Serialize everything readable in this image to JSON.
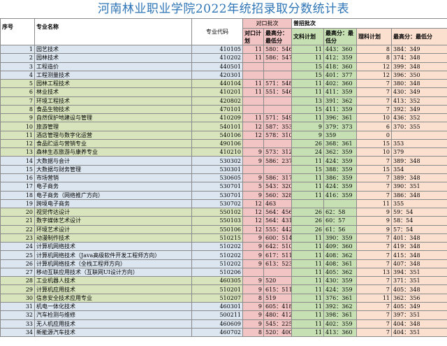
{
  "title": "河南林业职业学院2022年统招录取分数统计表",
  "headers": {
    "seq": "序号",
    "major": "专业名称",
    "code": "专业代码",
    "duikou_group": "对口批次",
    "puzhao_group": "普招批次",
    "dk_plan": "对口计划",
    "dk_score": "最高分：最低分",
    "wk_plan": "文科计划",
    "wk_score": "最高分：最低分",
    "lk_plan": "理科计划",
    "lk_score": "最高分：最低分"
  },
  "rows": [
    {
      "seq": "1",
      "major": "园艺技术",
      "code": "410105",
      "dk_plan": "11",
      "dk_score": "580：546",
      "wk_plan": "11",
      "wk_score": "443：360",
      "lk_plan": "8",
      "lk_score": "384：349"
    },
    {
      "seq": "2",
      "major": "园林技术",
      "code": "410202",
      "dk_plan": "11",
      "dk_score": "586：547",
      "wk_plan": "11",
      "wk_score": "412：359",
      "lk_plan": "8",
      "lk_score": "374：348"
    },
    {
      "seq": "3",
      "major": "工程造价",
      "code": "440501",
      "dk_plan": "",
      "dk_score": "",
      "wk_plan": "15",
      "wk_score": "418：360",
      "lk_plan": "12",
      "lk_score": "399：348"
    },
    {
      "seq": "4",
      "major": "工程测量技术",
      "code": "420301",
      "dk_plan": "",
      "dk_score": "",
      "wk_plan": "15",
      "wk_score": "401：377",
      "lk_plan": "12",
      "lk_score": "396：350"
    },
    {
      "seq": "5",
      "major": "园林工程技术",
      "code": "440104",
      "dk_plan": "11",
      "dk_score": "571：548",
      "wk_plan": "11",
      "wk_score": "402：360",
      "lk_plan": "7",
      "lk_score": "380：348"
    },
    {
      "seq": "6",
      "major": "林业技术",
      "code": "410201",
      "dk_plan": "11",
      "dk_score": "551：546",
      "wk_plan": "11",
      "wk_score": "411：359",
      "lk_plan": "7",
      "lk_score": "430：349"
    },
    {
      "seq": "7",
      "major": "环境工程技术",
      "code": "420802",
      "dk_plan": "",
      "dk_score": "",
      "wk_plan": "13",
      "wk_score": "391：362",
      "lk_plan": "7",
      "lk_score": "413：352"
    },
    {
      "seq": "8",
      "major": "食品生物技术",
      "code": "470101",
      "dk_plan": "",
      "dk_score": "",
      "wk_plan": "15",
      "wk_score": "411：359",
      "lk_plan": "7",
      "lk_score": "392：349"
    },
    {
      "seq": "9",
      "major": "自然保护地建设与管理",
      "code": "410209",
      "dk_plan": "11",
      "dk_score": "571：549",
      "wk_plan": "11",
      "wk_score": "396：361",
      "lk_plan": "10",
      "lk_score": "436：352"
    },
    {
      "seq": "10",
      "major": "旅游管理",
      "code": "540101",
      "dk_plan": "12",
      "dk_score": "587：353",
      "wk_plan": "9",
      "wk_score": "379：373",
      "lk_plan": "6",
      "lk_score": "370：355"
    },
    {
      "seq": "11",
      "major": "酒店管理与数字化运营",
      "code": "540106",
      "dk_plan": "12",
      "dk_score": "578：310",
      "wk_plan": "9",
      "wk_score": "359",
      "lk_plan": "0",
      "lk_score": ""
    },
    {
      "seq": "12",
      "major": "食品贮运与营销专业",
      "code": "490106",
      "dk_plan": "",
      "dk_score": "",
      "wk_plan": "26",
      "wk_score": "368：361",
      "lk_plan": "15",
      "lk_score": "353"
    },
    {
      "seq": "13",
      "major": "森林生态旅游与康养专业",
      "code": "410210",
      "dk_plan": "9",
      "dk_score": "573：312",
      "wk_plan": "24",
      "wk_score": "362：359",
      "lk_plan": "10",
      "lk_score": "379"
    },
    {
      "seq": "14",
      "major": "大数据与会计",
      "code": "530302",
      "dk_plan": "9",
      "dk_score": "586：237",
      "wk_plan": "11",
      "wk_score": "424：359",
      "lk_plan": "7",
      "lk_score": "389：348"
    },
    {
      "seq": "15",
      "major": "大数据与财务管理",
      "code": "530301",
      "dk_plan": "",
      "dk_score": "",
      "wk_plan": "15",
      "wk_score": "388：359",
      "lk_plan": "15",
      "lk_score": "354"
    },
    {
      "seq": "16",
      "major": "市场营销",
      "code": "530605",
      "dk_plan": "9",
      "dk_score": "586：317",
      "wk_plan": "11",
      "wk_score": "386：359",
      "lk_plan": "7",
      "lk_score": "389：348"
    },
    {
      "seq": "17",
      "major": "电子商务",
      "code": "530701",
      "dk_plan": "5",
      "dk_score": "543：320",
      "wk_plan": "11",
      "wk_score": "424：359",
      "lk_plan": "7",
      "lk_score": "390：351"
    },
    {
      "seq": "18",
      "major": "电子商务（网络推广方向）",
      "code": "530701",
      "dk_plan": "9",
      "dk_score": "560：328",
      "wk_plan": "11",
      "wk_score": "416：359",
      "lk_plan": "7",
      "lk_score": "386：348"
    },
    {
      "seq": "19",
      "major": "跨境电子商务",
      "code": "530702",
      "dk_plan": "12",
      "dk_score": "463",
      "wk_plan": "",
      "wk_score": "",
      "lk_plan": "11",
      "lk_score": "355"
    },
    {
      "seq": "20",
      "major": "视觉传达设计",
      "code": "550102",
      "dk_plan": "12",
      "dk_score": "564：456",
      "wk_plan": "26",
      "wk_score": "62：58",
      "lk_plan": "9",
      "lk_score": "59：54"
    },
    {
      "seq": "21",
      "major": "数字媒体艺术设计",
      "code": "550103",
      "dk_plan": "12",
      "dk_score": "564：431",
      "wk_plan": "26",
      "wk_score": "60：57",
      "lk_plan": "9",
      "lk_score": "58：54"
    },
    {
      "seq": "22",
      "major": "环境艺术设计",
      "code": "550106",
      "dk_plan": "12",
      "dk_score": "555：442",
      "wk_plan": "26",
      "wk_score": "61：56",
      "lk_plan": "9",
      "lk_score": "57：54"
    },
    {
      "seq": "23",
      "major": "动漫制作技术",
      "code": "510215",
      "dk_plan": "9",
      "dk_score": "600：514",
      "wk_plan": "11",
      "wk_score": "390：359",
      "lk_plan": "7",
      "lk_score": "401：348"
    },
    {
      "seq": "24",
      "major": "计算机网络技术",
      "code": "510202",
      "dk_plan": "9",
      "dk_score": "642：510",
      "wk_plan": "11",
      "wk_score": "409：360",
      "lk_plan": "7",
      "lk_score": "419：348"
    },
    {
      "seq": "25",
      "major": "计算机网络技术（Java高级软件开发工程师方向）",
      "code": "510202",
      "dk_plan": "9",
      "dk_score": "617：511",
      "wk_plan": "11",
      "wk_score": "408：362",
      "lk_plan": "7",
      "lk_score": "415：348"
    },
    {
      "seq": "26",
      "major": "计算机网络技术（全栈工程师方向）",
      "code": "510202",
      "dk_plan": "9",
      "dk_score": "613：523",
      "wk_plan": "11",
      "wk_score": "408：361",
      "lk_plan": "7",
      "lk_score": "407：348"
    },
    {
      "seq": "27",
      "major": "移动互联应用技术（互联网UI设计方向）",
      "code": "510206",
      "dk_plan": "",
      "dk_score": "",
      "wk_plan": "11",
      "wk_score": "405：362",
      "lk_plan": "13",
      "lk_score": "394：351"
    },
    {
      "seq": "28",
      "major": "工业机器人技术",
      "code": "460305",
      "dk_plan": "9",
      "dk_score": "520",
      "wk_plan": "11",
      "wk_score": "430：359",
      "lk_plan": "7",
      "lk_score": "371：351"
    },
    {
      "seq": "29",
      "major": "计算机应用技术",
      "code": "510201",
      "dk_plan": "9",
      "dk_score": "615：511",
      "wk_plan": "11",
      "wk_score": "424：359",
      "lk_plan": "7",
      "lk_score": "405：348"
    },
    {
      "seq": "30",
      "major": "信息安全技术应用专业",
      "code": "510207",
      "dk_plan": "8",
      "dk_score": "519",
      "wk_plan": "11",
      "wk_score": "376：361",
      "lk_plan": "11",
      "lk_score": "362：356"
    },
    {
      "seq": "31",
      "major": "机电一体化技术",
      "code": "460301",
      "dk_plan": "9",
      "dk_score": "605：418",
      "wk_plan": "11",
      "wk_score": "392：362",
      "lk_plan": "7",
      "lk_score": "405：349"
    },
    {
      "seq": "32",
      "major": "汽车检测与维修",
      "code": "500211",
      "dk_plan": "9",
      "dk_score": "480：412",
      "wk_plan": "11",
      "wk_score": "398：361",
      "lk_plan": "7",
      "lk_score": "397：351"
    },
    {
      "seq": "33",
      "major": "无人机应用技术",
      "code": "460609",
      "dk_plan": "9",
      "dk_score": "545：225",
      "wk_plan": "11",
      "wk_score": "402：359",
      "lk_plan": "7",
      "lk_score": "404：348"
    },
    {
      "seq": "34",
      "major": "新能源汽车技术",
      "code": "460702",
      "dk_plan": "8",
      "dk_score": "520：400",
      "wk_plan": "11",
      "wk_score": "413：360",
      "lk_plan": "7",
      "lk_score": "404：351"
    }
  ],
  "colors": {
    "title": "#2e75b6",
    "duikou": "#f2c4c4",
    "wenke": "#c6e0b4",
    "like": "#fbe0d0",
    "band_blue": "#dce6f1",
    "band_green": "#d8e4bc"
  }
}
